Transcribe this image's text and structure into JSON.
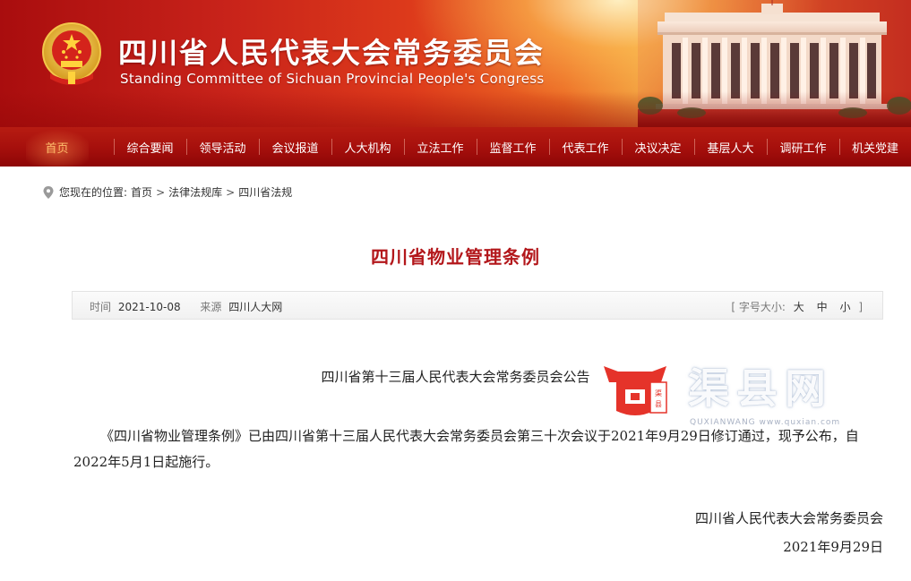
{
  "header": {
    "title_cn": "四川省人民代表大会常务委员会",
    "title_en": "Standing Committee of Sichuan Provincial People's Congress",
    "emblem_icon": "national-emblem-icon",
    "building_image": "people-congress-building",
    "colors": {
      "banner_red": "#c8231a",
      "nav_red": "#a50f0c",
      "accent_gold": "#ffd27a",
      "title_red": "#b3171b"
    }
  },
  "nav": {
    "items": [
      {
        "label": "首页",
        "active": true
      },
      {
        "label": "综合要闻"
      },
      {
        "label": "领导活动"
      },
      {
        "label": "会议报道"
      },
      {
        "label": "人大机构"
      },
      {
        "label": "立法工作"
      },
      {
        "label": "监督工作"
      },
      {
        "label": "代表工作"
      },
      {
        "label": "决议决定"
      },
      {
        "label": "基层人大"
      },
      {
        "label": "调研工作"
      },
      {
        "label": "机关党建"
      }
    ]
  },
  "breadcrumb": {
    "prefix": "您现在的位置:",
    "items": [
      "首页",
      "法律法规库",
      "四川省法规"
    ],
    "sep": ">"
  },
  "article": {
    "title": "四川省物业管理条例",
    "meta": {
      "time_label": "时间",
      "time_value": "2021-10-08",
      "source_label": "来源",
      "source_value": "四川人大网",
      "font_size_label": "[ 字号大小:",
      "font_size_close": "]",
      "sizes": [
        "大",
        "中",
        "小"
      ]
    },
    "notice_title": "四川省第十三届人民代表大会常务委员会公告",
    "body": "《四川省物业管理条例》已由四川省第十三届人民代表大会常务委员会第三十次会议于2021年9月29日修订通过，现予公布，自2022年5月1日起施行。",
    "signature_org": "四川省人民代表大会常务委员会",
    "signature_date": "2021年9月29日"
  },
  "watermark": {
    "logo_icon": "qushi-logo-icon",
    "logo_text": "渠县",
    "text": "渠县网",
    "subtext": "QUXIANWANG www.quxian.com"
  }
}
